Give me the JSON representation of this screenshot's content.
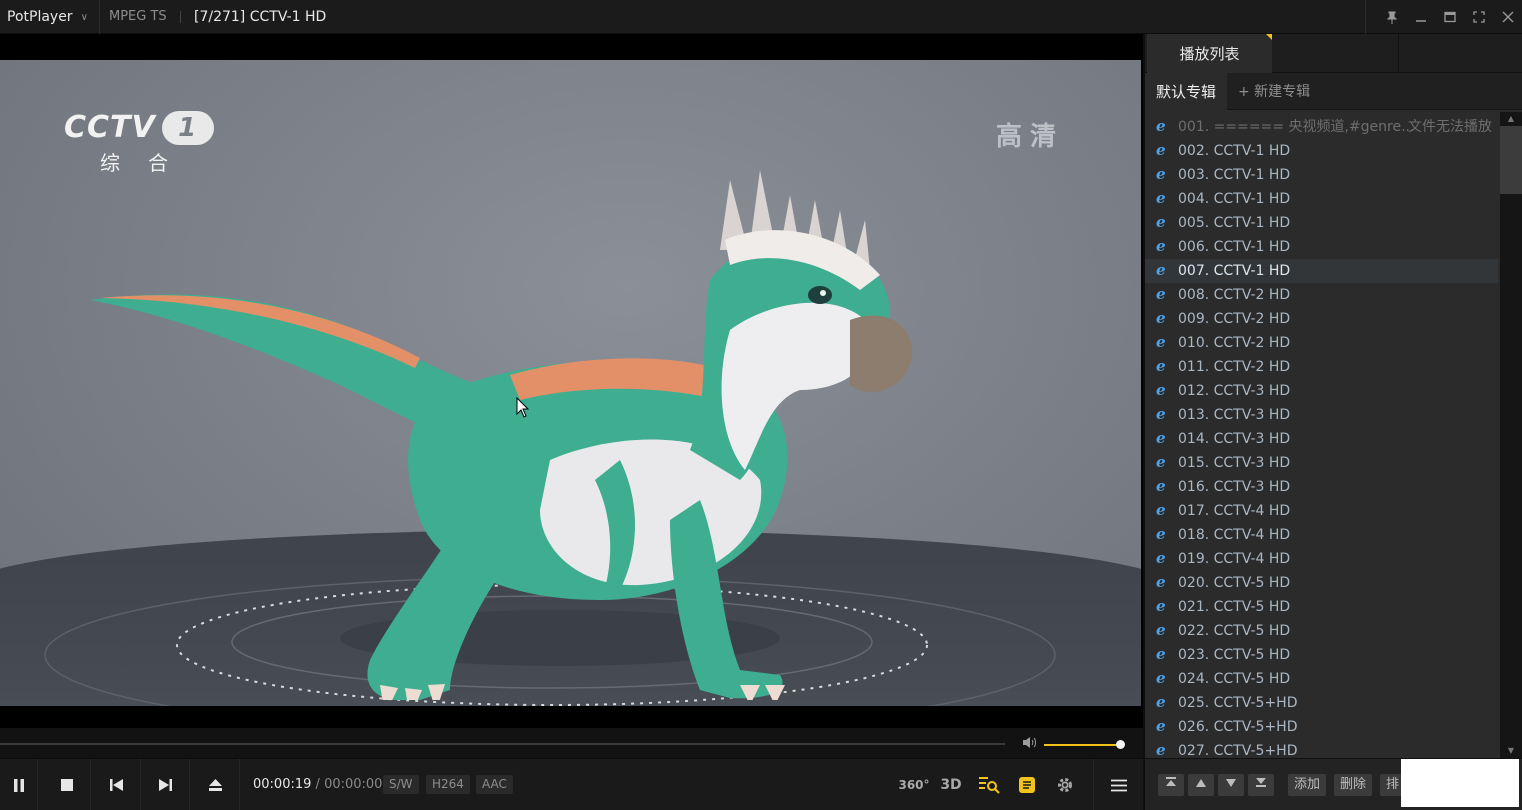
{
  "titlebar": {
    "app_name": "PotPlayer",
    "format": "MPEG TS",
    "now_playing": "[7/271] CCTV-1 HD"
  },
  "video": {
    "logo_text": "CCTV",
    "logo_number": "1",
    "logo_sub": "综合",
    "hd_text": "高清"
  },
  "controls": {
    "current_time": "00:00:19",
    "separator": "/",
    "duration": "00:00:00",
    "tags": [
      "S/W",
      "H264",
      "AAC"
    ],
    "icon_360": "360°",
    "icon_3d": "3D",
    "volume_level": 0.95
  },
  "playlist": {
    "tab_label": "播放列表",
    "album_active": "默认专辑",
    "album_new": "+ 新建专辑",
    "items": [
      {
        "label": "001. ====== 央视频道,#genre...",
        "note": "文件无法播放",
        "state": "disabled"
      },
      {
        "label": "002. CCTV-1 HD",
        "state": "normal"
      },
      {
        "label": "003. CCTV-1 HD",
        "state": "normal"
      },
      {
        "label": "004. CCTV-1 HD",
        "state": "normal"
      },
      {
        "label": "005. CCTV-1 HD",
        "state": "normal"
      },
      {
        "label": "006. CCTV-1 HD",
        "state": "normal"
      },
      {
        "label": "007. CCTV-1 HD",
        "state": "active"
      },
      {
        "label": "008. CCTV-2 HD",
        "state": "normal"
      },
      {
        "label": "009. CCTV-2 HD",
        "state": "normal"
      },
      {
        "label": "010. CCTV-2 HD",
        "state": "normal"
      },
      {
        "label": "011. CCTV-2 HD",
        "state": "normal"
      },
      {
        "label": "012. CCTV-3 HD",
        "state": "normal"
      },
      {
        "label": "013. CCTV-3 HD",
        "state": "normal"
      },
      {
        "label": "014. CCTV-3 HD",
        "state": "normal"
      },
      {
        "label": "015. CCTV-3 HD",
        "state": "normal"
      },
      {
        "label": "016. CCTV-3 HD",
        "state": "normal"
      },
      {
        "label": "017. CCTV-4 HD",
        "state": "normal"
      },
      {
        "label": "018. CCTV-4 HD",
        "state": "normal"
      },
      {
        "label": "019. CCTV-4 HD",
        "state": "normal"
      },
      {
        "label": "020. CCTV-5 HD",
        "state": "normal"
      },
      {
        "label": "021. CCTV-5 HD",
        "state": "normal"
      },
      {
        "label": "022. CCTV-5 HD",
        "state": "normal"
      },
      {
        "label": "023. CCTV-5 HD",
        "state": "normal"
      },
      {
        "label": "024. CCTV-5 HD",
        "state": "normal"
      },
      {
        "label": "025. CCTV-5+HD",
        "state": "normal"
      },
      {
        "label": "026. CCTV-5+HD",
        "state": "normal"
      },
      {
        "label": "027. CCTV-5+HD",
        "state": "normal"
      }
    ],
    "footer": {
      "add_label": "添加",
      "delete_label": "删除",
      "sort_label": "排"
    }
  },
  "colors": {
    "accent": "#f0c419",
    "item_text": "#aab7c3",
    "panel_bg": "#2b2b2b"
  }
}
